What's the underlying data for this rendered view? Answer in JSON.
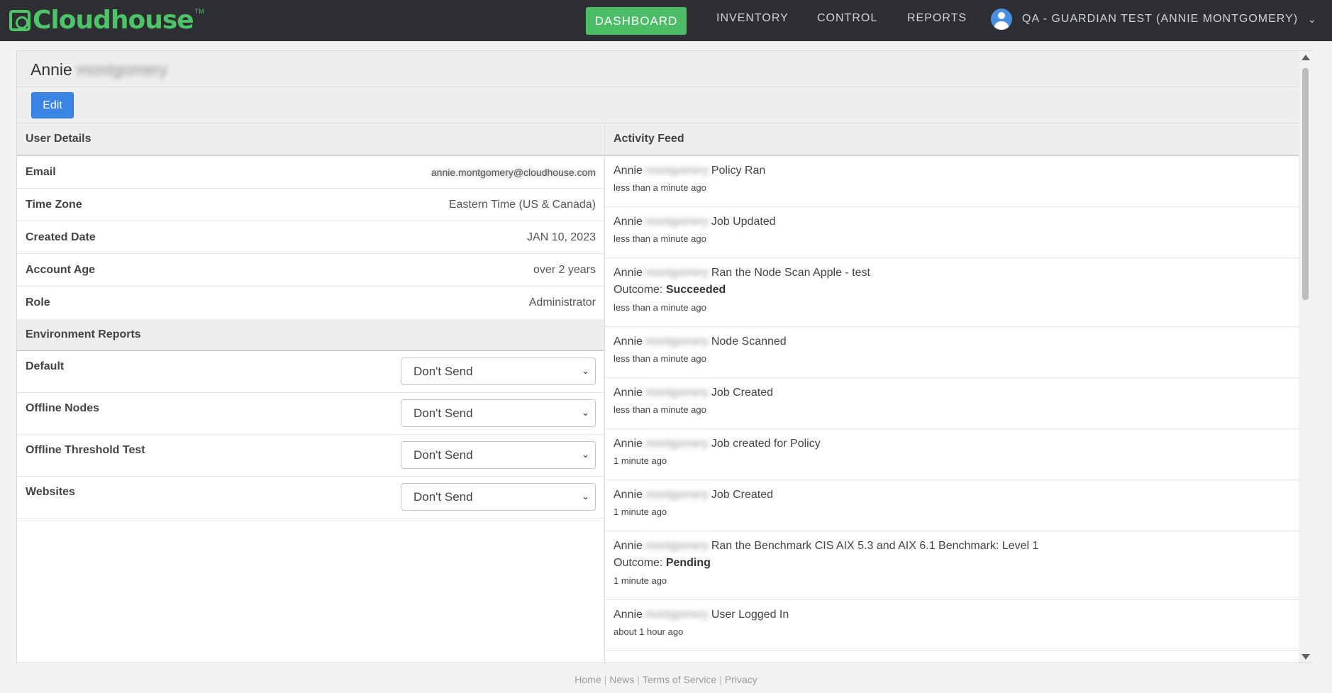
{
  "app": {
    "brand": "Cloudhouse",
    "tm": "TM"
  },
  "nav": {
    "dashboard": "DASHBOARD",
    "inventory": "INVENTORY",
    "control": "CONTROL",
    "reports": "REPORTS",
    "user": "QA - GUARDIAN TEST (ANNIE MONTGOMERY)"
  },
  "user": {
    "first_name": "Annie",
    "last_name_blurred": "montgomery",
    "edit_label": "Edit"
  },
  "details": {
    "section_title": "User Details",
    "rows": [
      {
        "label": "Email",
        "value": "annie.montgomery@cloudhouse.com"
      },
      {
        "label": "Time Zone",
        "value": "Eastern Time (US & Canada)"
      },
      {
        "label": "Created Date",
        "value": "JAN 10, 2023"
      },
      {
        "label": "Account Age",
        "value": "over 2 years"
      },
      {
        "label": "Role",
        "value": "Administrator"
      }
    ]
  },
  "env_reports": {
    "section_title": "Environment Reports",
    "rows": [
      {
        "label": "Default",
        "value": "Don't Send"
      },
      {
        "label": "Offline Nodes",
        "value": "Don't Send"
      },
      {
        "label": "Offline Threshold Test",
        "value": "Don't Send"
      },
      {
        "label": "Websites",
        "value": "Don't Send"
      }
    ]
  },
  "feed": {
    "section_title": "Activity Feed",
    "outcome_label": "Outcome:",
    "items": [
      {
        "name": "Annie",
        "blurred": "montgomery",
        "action": "Policy Ran",
        "time": "less than a minute ago"
      },
      {
        "name": "Annie",
        "blurred": "montgomery",
        "action": "Job Updated",
        "time": "less than a minute ago"
      },
      {
        "name": "Annie",
        "blurred": "montgomery",
        "action": "Ran the Node Scan Apple - test",
        "outcome": "Succeeded",
        "time": "less than a minute ago"
      },
      {
        "name": "Annie",
        "blurred": "montgomery",
        "action": "Node Scanned",
        "time": "less than a minute ago"
      },
      {
        "name": "Annie",
        "blurred": "montgomery",
        "action": "Job Created",
        "time": "less than a minute ago"
      },
      {
        "name": "Annie",
        "blurred": "montgomery",
        "action": "Job created for Policy",
        "time": "1 minute ago"
      },
      {
        "name": "Annie",
        "blurred": "montgomery",
        "action": "Job Created",
        "time": "1 minute ago"
      },
      {
        "name": "Annie",
        "blurred": "montgomery",
        "action": "Ran the Benchmark CIS AIX 5.3 and AIX 6.1 Benchmark: Level 1",
        "outcome": "Pending",
        "time": "1 minute ago"
      },
      {
        "name": "Annie",
        "blurred": "montgomery",
        "action": "User Logged In",
        "time": "about 1 hour ago"
      }
    ]
  },
  "footer": {
    "home": "Home",
    "news": "News",
    "terms": "Terms of Service",
    "privacy": "Privacy",
    "sep": "|"
  },
  "colors": {
    "topbar": "#2d2f33",
    "brand_green": "#4cc467",
    "dashboard_button": "#4cbd66",
    "edit_button": "#3a84e6"
  }
}
